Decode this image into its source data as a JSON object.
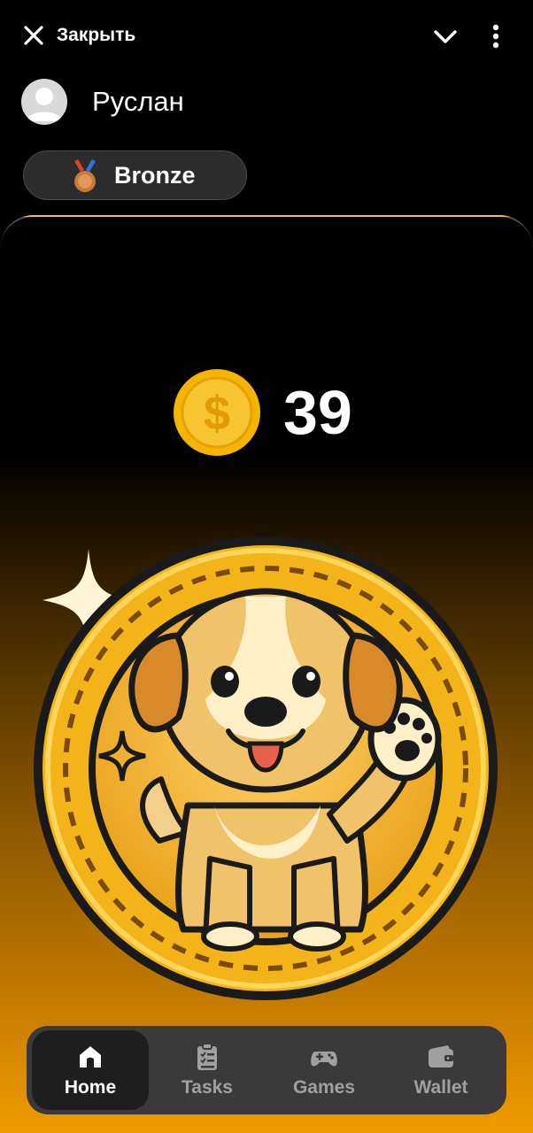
{
  "header": {
    "close_label": "Закрыть"
  },
  "profile": {
    "username": "Руслан"
  },
  "rank": {
    "label": "Bronze"
  },
  "balance": {
    "value": "39",
    "currency_icon": "dollar-coin-icon"
  },
  "tap_target": {
    "icon": "puppy-coin-icon"
  },
  "nav": {
    "items": [
      {
        "label": "Home",
        "icon": "home-icon",
        "active": true
      },
      {
        "label": "Tasks",
        "icon": "clipboard-icon",
        "active": false
      },
      {
        "label": "Games",
        "icon": "gamepad-icon",
        "active": false
      },
      {
        "label": "Wallet",
        "icon": "wallet-icon",
        "active": false
      }
    ]
  },
  "colors": {
    "accent_gold": "#f5b800",
    "panel_bottom": "#f19b00",
    "nav_bg": "#3a3a3a"
  }
}
